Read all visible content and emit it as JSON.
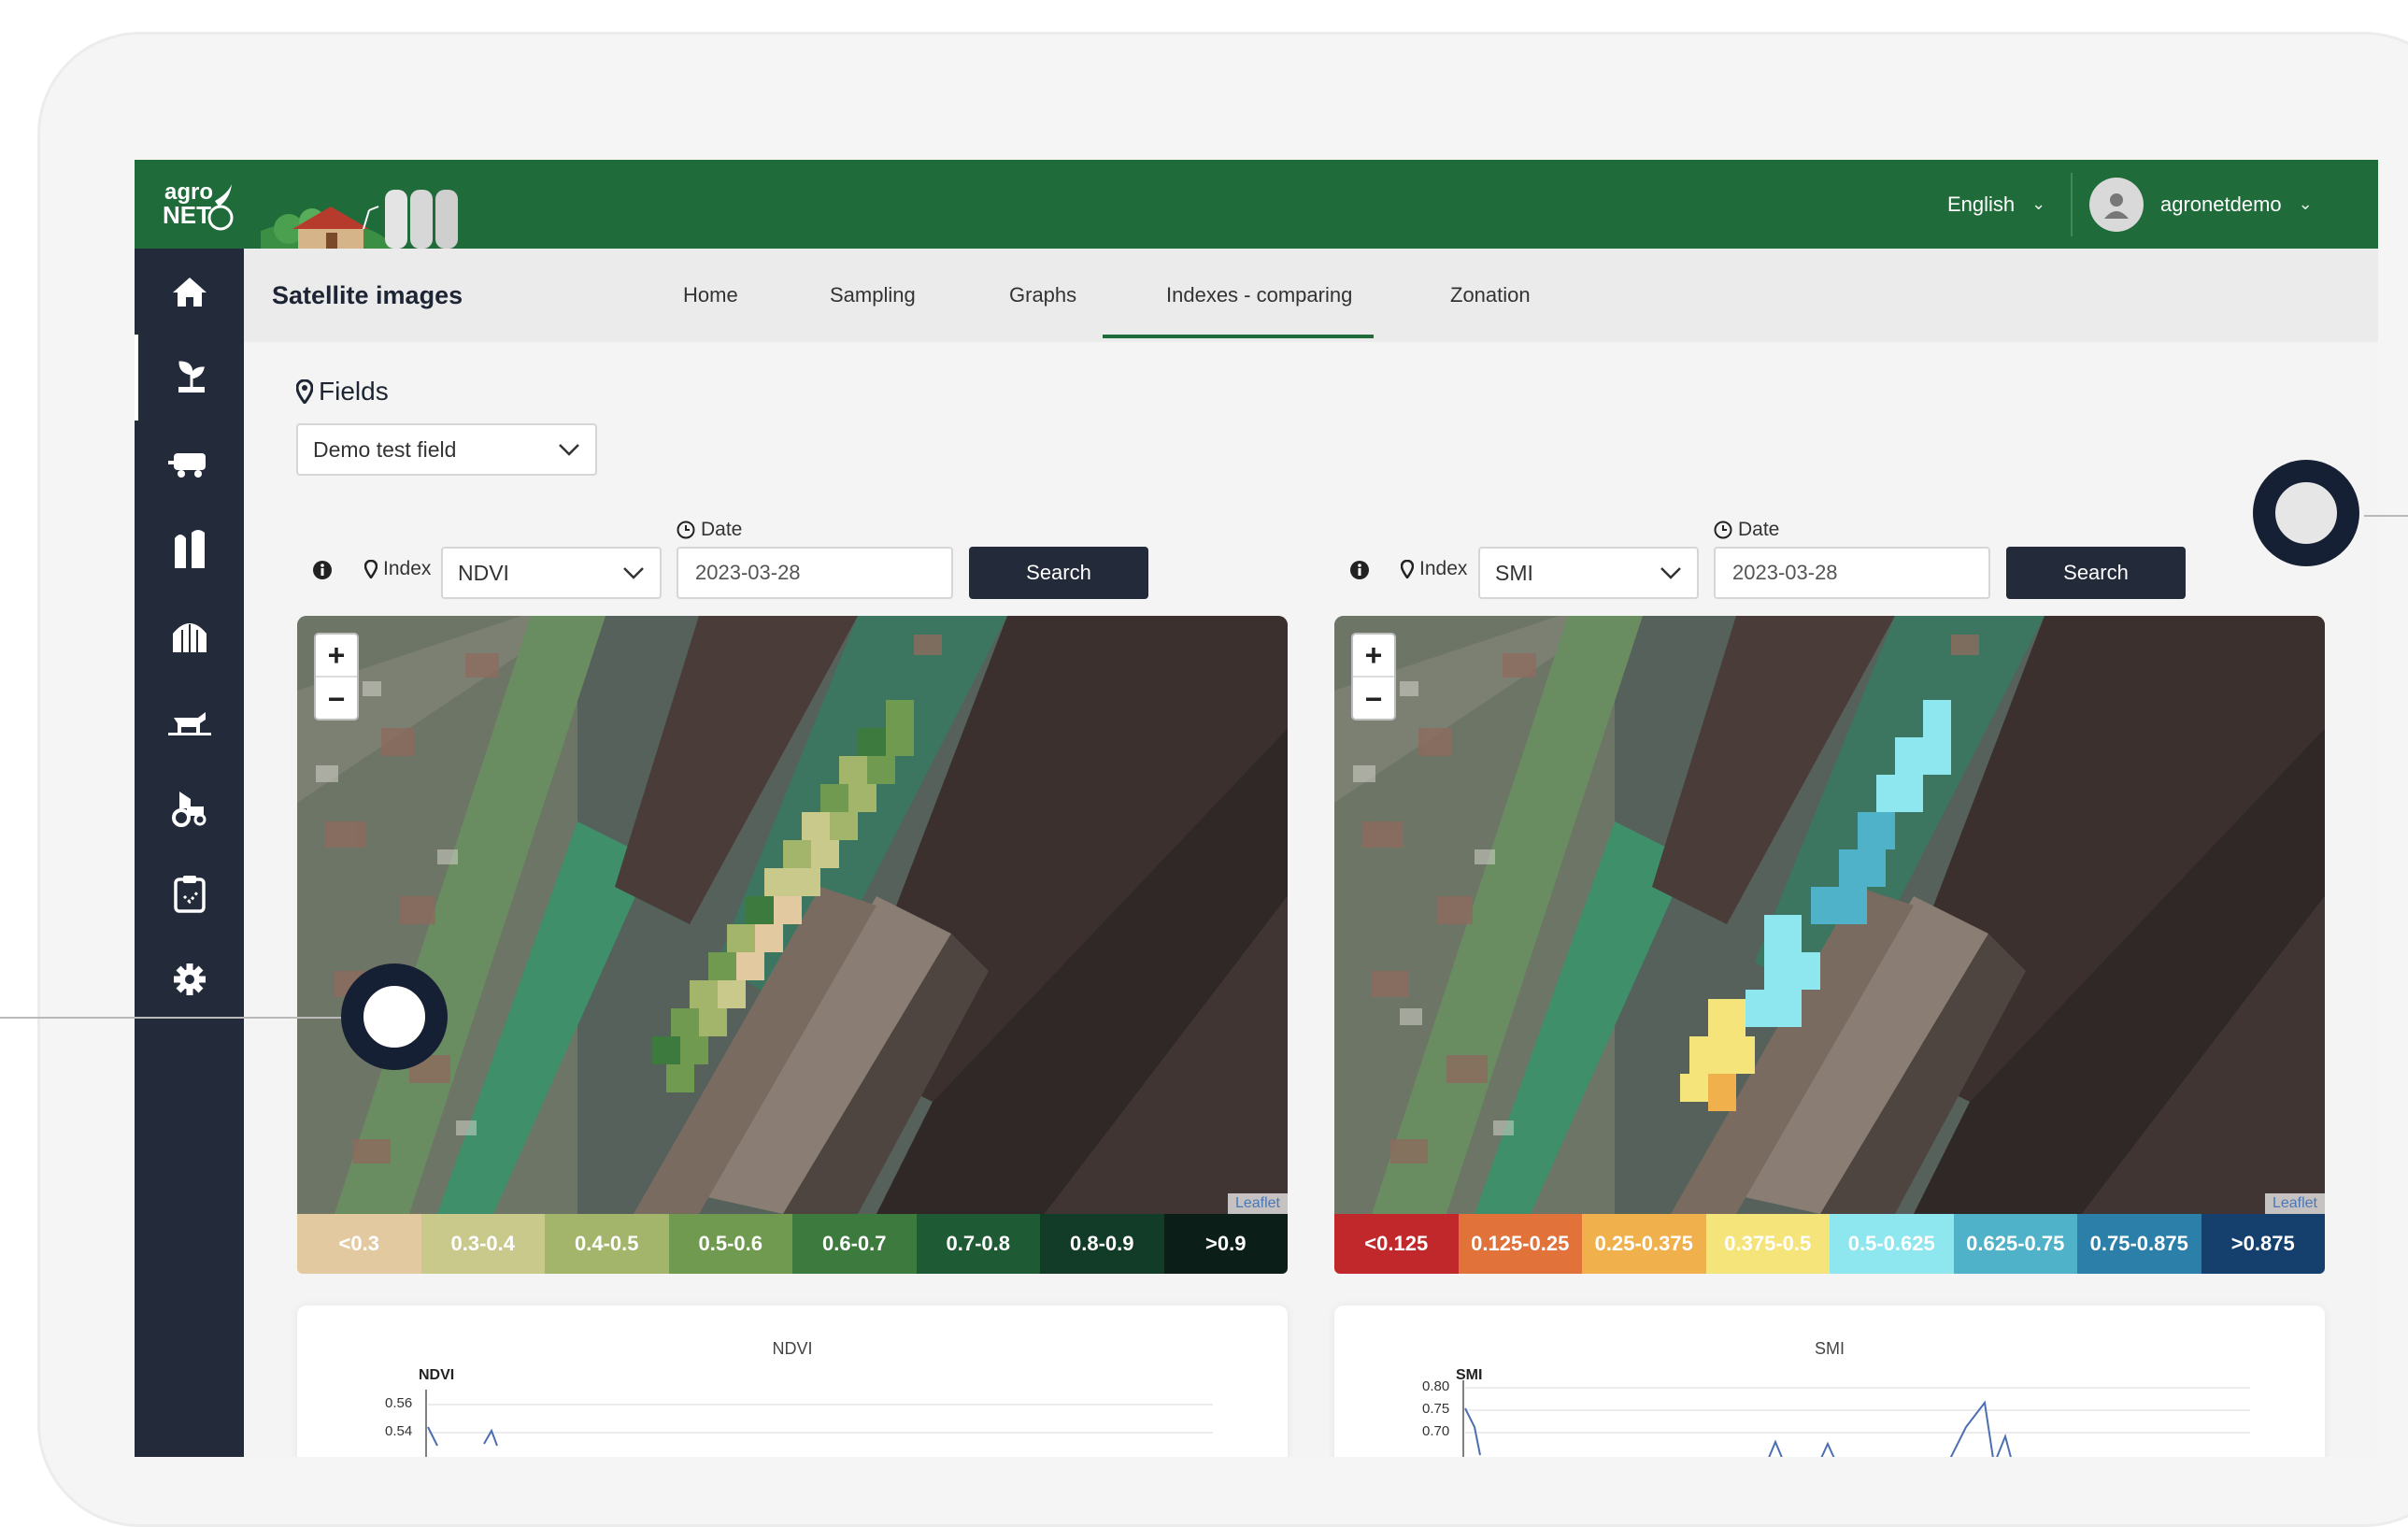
{
  "header": {
    "logo_text": "agro NET",
    "language": "English",
    "username": "agronetdemo"
  },
  "sidebar": {
    "items": [
      {
        "icon": "home-icon"
      },
      {
        "icon": "plant-icon"
      },
      {
        "icon": "tractor-trailer-icon"
      },
      {
        "icon": "silo-icon"
      },
      {
        "icon": "greenhouse-icon"
      },
      {
        "icon": "livestock-icon"
      },
      {
        "icon": "tractor-icon"
      },
      {
        "icon": "clipboard-icon"
      },
      {
        "icon": "gear-icon"
      }
    ]
  },
  "tabs": {
    "title": "Satellite images",
    "items": [
      {
        "label": "Home"
      },
      {
        "label": "Sampling"
      },
      {
        "label": "Graphs"
      },
      {
        "label": "Indexes - comparing",
        "active": true
      },
      {
        "label": "Zonation"
      }
    ]
  },
  "fields": {
    "label": "Fields",
    "selected": "Demo test field"
  },
  "left_panel": {
    "index_label": "Index",
    "index_value": "NDVI",
    "date_label": "Date",
    "date_value": "2023-03-28",
    "search_label": "Search",
    "zoom_in": "+",
    "zoom_out": "−",
    "attribution": "Leaflet",
    "legend": [
      {
        "label": "<0.3",
        "color": "#e3c9a0"
      },
      {
        "label": "0.3-0.4",
        "color": "#c9c98c"
      },
      {
        "label": "0.4-0.5",
        "color": "#a3b56a"
      },
      {
        "label": "0.5-0.6",
        "color": "#6f9a4f"
      },
      {
        "label": "0.6-0.7",
        "color": "#3c7a3e"
      },
      {
        "label": "0.7-0.8",
        "color": "#1e5a33"
      },
      {
        "label": "0.8-0.9",
        "color": "#123b28"
      },
      {
        "label": ">0.9",
        "color": "#0b1e18"
      }
    ],
    "chart_title": "NDVI",
    "chart_ylabel": "NDVI",
    "chart_ticks": [
      "0.56",
      "0.54"
    ]
  },
  "right_panel": {
    "index_label": "Index",
    "index_value": "SMI",
    "date_label": "Date",
    "date_value": "2023-03-28",
    "search_label": "Search",
    "zoom_in": "+",
    "zoom_out": "−",
    "attribution": "Leaflet",
    "legend": [
      {
        "label": "<0.125",
        "color": "#c0282c"
      },
      {
        "label": "0.125-0.25",
        "color": "#e0723a"
      },
      {
        "label": "0.25-0.375",
        "color": "#f0b04c"
      },
      {
        "label": "0.375-0.5",
        "color": "#f5e47a"
      },
      {
        "label": "0.5-0.625",
        "color": "#8ee6ee"
      },
      {
        "label": "0.625-0.75",
        "color": "#4fb2c8"
      },
      {
        "label": "0.75-0.875",
        "color": "#2c7fa8"
      },
      {
        "label": ">0.875",
        "color": "#15406e"
      }
    ],
    "chart_title": "SMI",
    "chart_ylabel": "SMI",
    "chart_ticks": [
      "0.80",
      "0.75",
      "0.70"
    ]
  }
}
